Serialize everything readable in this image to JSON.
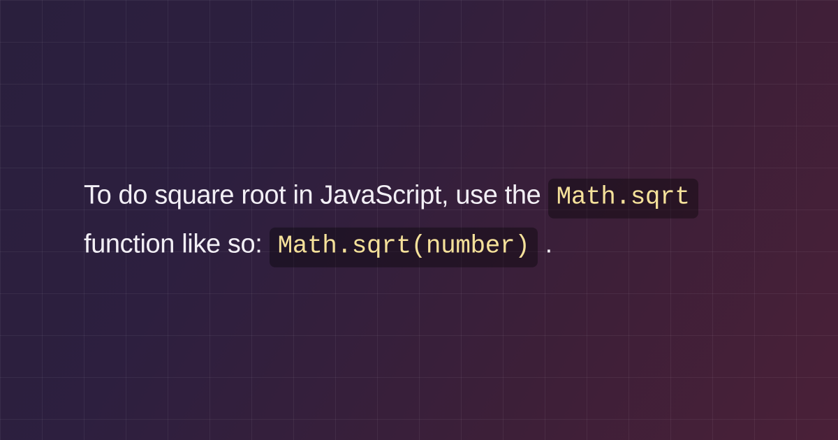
{
  "snippet": {
    "text_part1": "To do square root in JavaScript, use the ",
    "code1": "Math.sqrt",
    "text_part2": " function like so: ",
    "code2": "Math.sqrt(number)",
    "text_part3": " ."
  }
}
